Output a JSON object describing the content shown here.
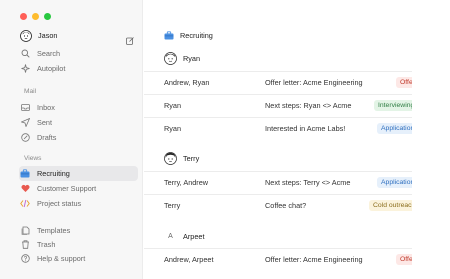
{
  "colors": {
    "traffic_red": "#ff5f57",
    "traffic_yellow": "#febc2e",
    "traffic_green": "#28c840",
    "accent_active": "#e8e8ea"
  },
  "sidebar": {
    "user": {
      "name": "Jason",
      "compose_icon": "compose-icon"
    },
    "top_items": [
      {
        "label": "Search",
        "icon": "search-icon"
      },
      {
        "label": "Autopilot",
        "icon": "autopilot-icon"
      }
    ],
    "mail_section": {
      "label": "Mail",
      "items": [
        {
          "label": "Inbox",
          "icon": "inbox-icon"
        },
        {
          "label": "Sent",
          "icon": "sent-icon"
        },
        {
          "label": "Drafts",
          "icon": "drafts-icon"
        }
      ]
    },
    "views_section": {
      "label": "Views",
      "items": [
        {
          "label": "Recruiting",
          "icon": "briefcase-icon",
          "active": true
        },
        {
          "label": "Customer Support",
          "icon": "heart-icon"
        },
        {
          "label": "Project status",
          "icon": "code-icon"
        }
      ]
    },
    "bottom_items": [
      {
        "label": "Templates",
        "icon": "templates-icon"
      },
      {
        "label": "Trash",
        "icon": "trash-icon"
      },
      {
        "label": "Help & support",
        "icon": "help-icon"
      }
    ]
  },
  "main": {
    "title": "Recruiting",
    "groups": [
      {
        "name": "Ryan",
        "rows": [
          {
            "who": "Andrew, Ryan",
            "subject": "Offer letter: Acme Engineering",
            "badge": "Offer"
          },
          {
            "who": "Ryan",
            "subject": "Next steps: Ryan <> Acme",
            "badge": "Interviewing"
          },
          {
            "who": "Ryan",
            "subject": "Interested in Acme Labs!",
            "badge": "Application"
          }
        ]
      },
      {
        "name": "Terry",
        "rows": [
          {
            "who": "Terry, Andrew",
            "subject": "Next steps: Terry <> Acme",
            "badge": "Application"
          },
          {
            "who": "Terry",
            "subject": "Coffee chat?",
            "badge": "Cold outreach"
          }
        ]
      },
      {
        "name": "Arpeet",
        "avatar_letter": "A",
        "rows": [
          {
            "who": "Andrew, Arpeet",
            "subject": "Offer letter: Acme Engineering",
            "badge": "Offer"
          }
        ]
      }
    ]
  }
}
